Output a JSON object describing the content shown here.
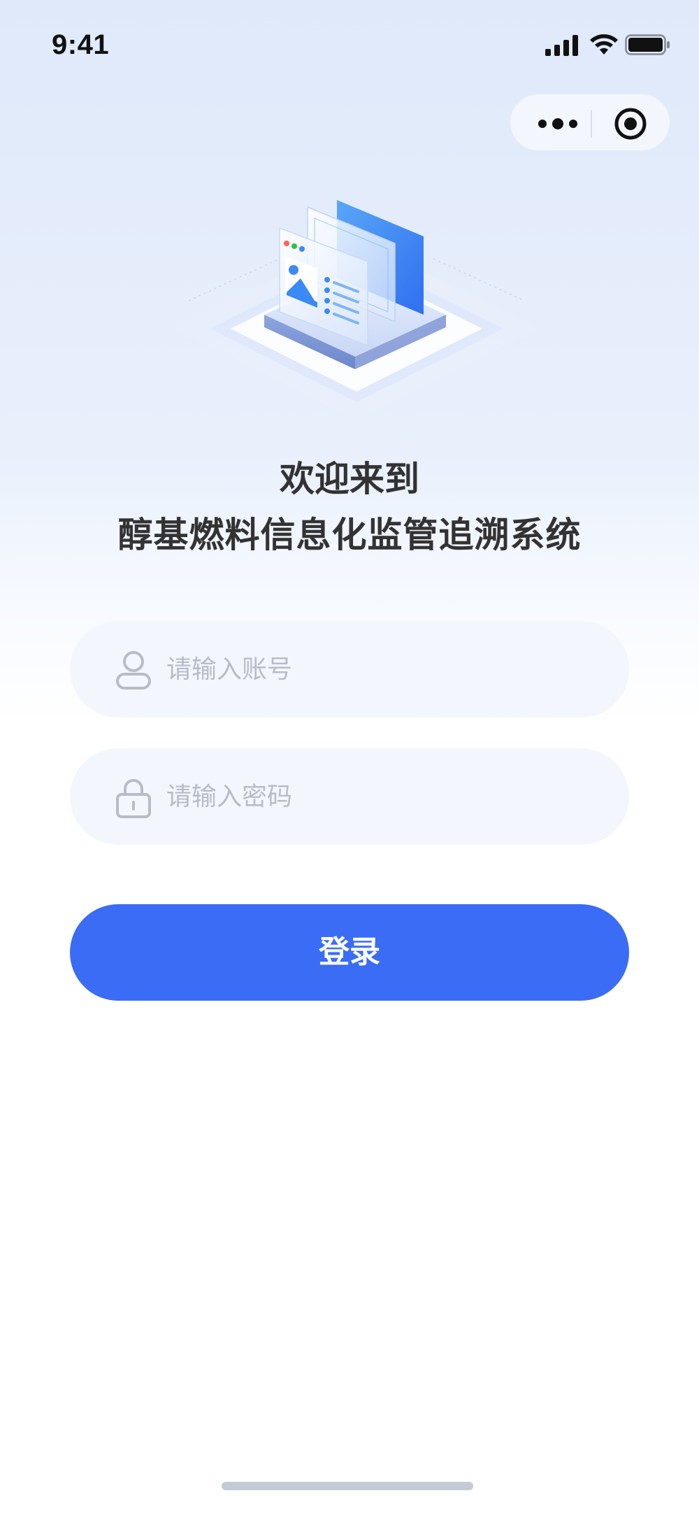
{
  "status_bar": {
    "time": "9:41"
  },
  "capsule": {
    "more_icon": "more-icon",
    "target_icon": "target-icon"
  },
  "header": {
    "welcome": "欢迎来到",
    "system_name": "醇基燃料信息化监管追溯系统"
  },
  "form": {
    "account": {
      "placeholder": "请输入账号",
      "value": "",
      "icon": "user-icon"
    },
    "password": {
      "placeholder": "请输入密码",
      "value": "",
      "icon": "lock-icon"
    },
    "login_label": "登录"
  },
  "colors": {
    "primary": "#3a6cf6",
    "field_bg": "#f3f6fd",
    "title": "#333333",
    "placeholder": "#b8bcc6"
  }
}
